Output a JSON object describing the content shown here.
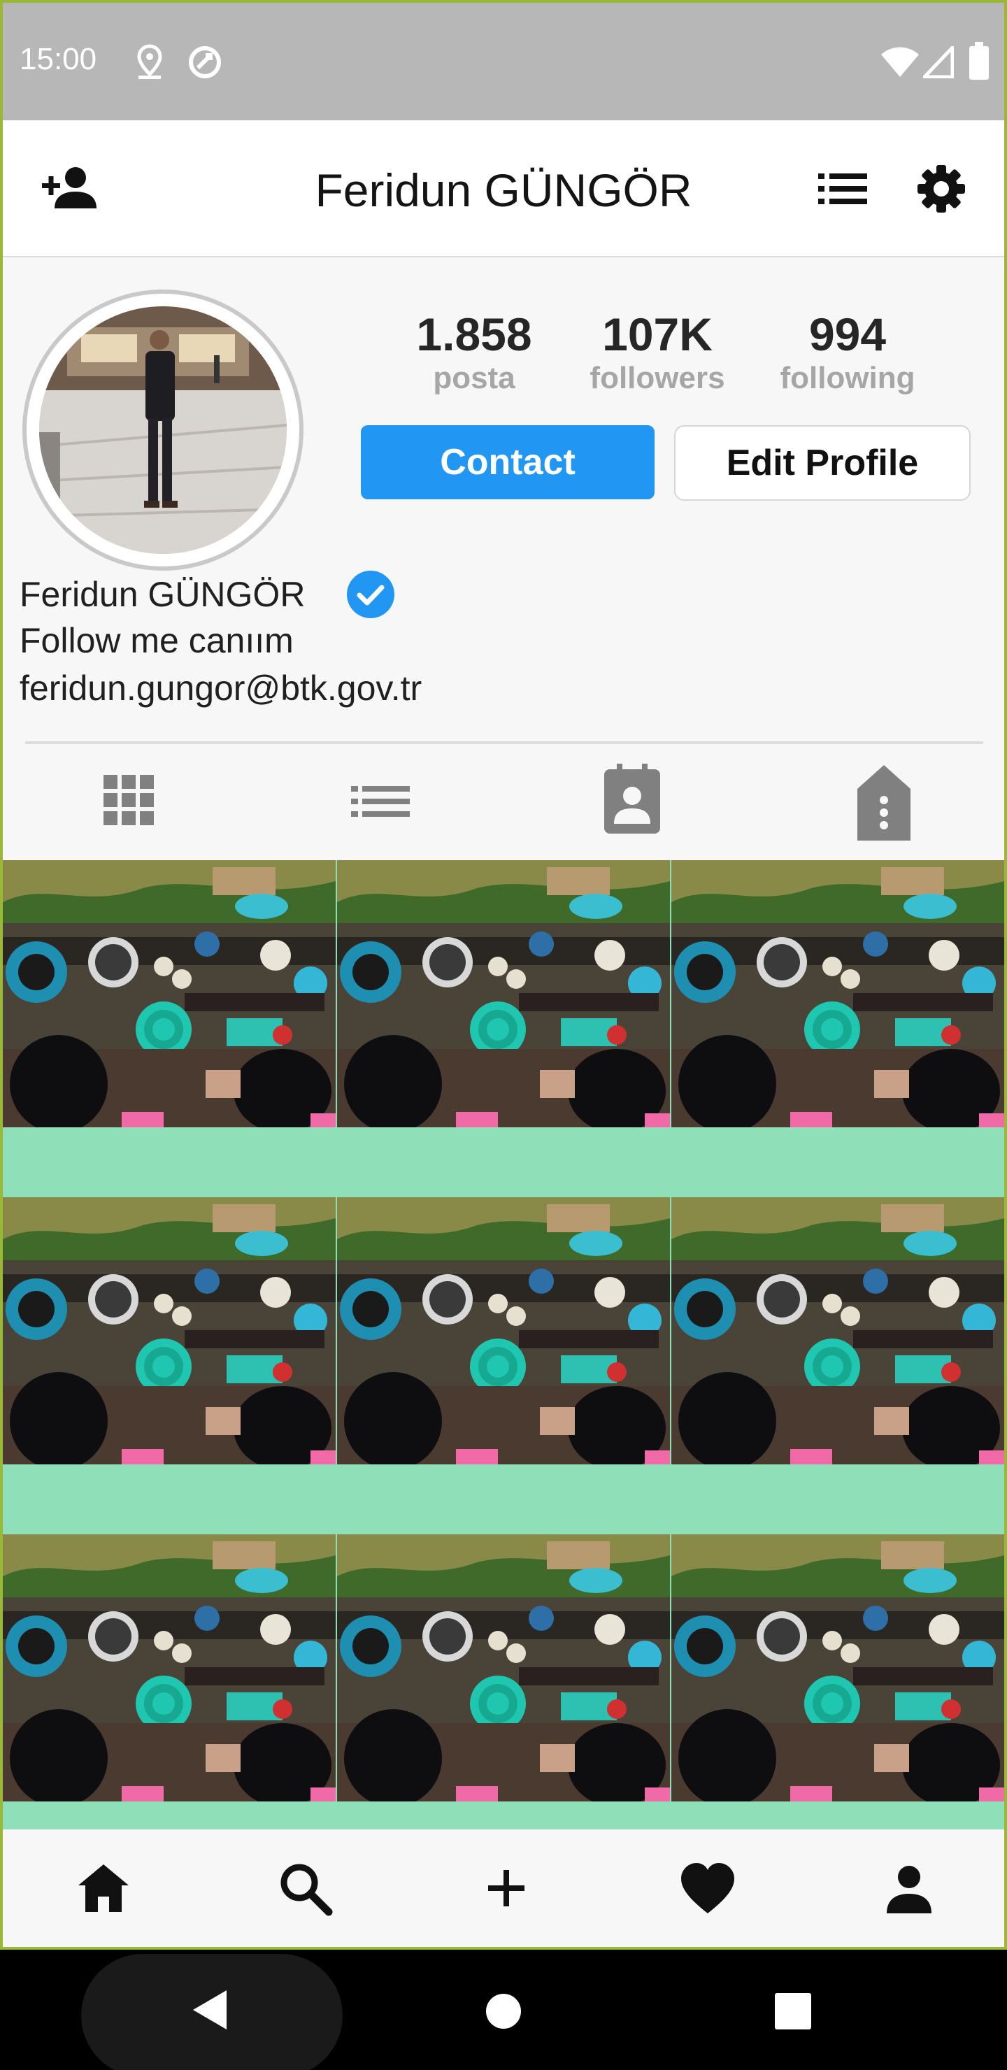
{
  "status_bar": {
    "time": "15:00",
    "left_icons": [
      "location-icon",
      "sync-icon"
    ],
    "right_icons": [
      "wifi-icon",
      "signal-icon",
      "battery-icon"
    ]
  },
  "app_bar": {
    "title": "Feridun GÜNGÖR",
    "left_icon": "add-person-icon",
    "right_icons": [
      "list-icon",
      "settings-icon"
    ]
  },
  "profile": {
    "stats": [
      {
        "value": "1.858",
        "label": "posta"
      },
      {
        "value": "107K",
        "label": "followers"
      },
      {
        "value": "994",
        "label": "following"
      }
    ],
    "contact_label": "Contact",
    "edit_label": "Edit Profile",
    "name": "Feridun GÜNGÖR",
    "bio": "Follow me canıım",
    "email": "feridun.gungor@btk.gov.tr",
    "verified": true
  },
  "tabs": [
    "grid-icon",
    "list-icon",
    "contact-card-icon",
    "tagged-icon"
  ],
  "grid": {
    "columns": 3,
    "visible_rows": 3
  },
  "bottom_nav": [
    "home-icon",
    "search-icon",
    "add-icon",
    "heart-icon",
    "person-icon"
  ],
  "system_nav": [
    "back-icon",
    "home-circle-icon",
    "recents-icon"
  ],
  "colors": {
    "accent": "#2196f3",
    "status_bar": "#b7b7b7",
    "frame": "#9ab838"
  }
}
